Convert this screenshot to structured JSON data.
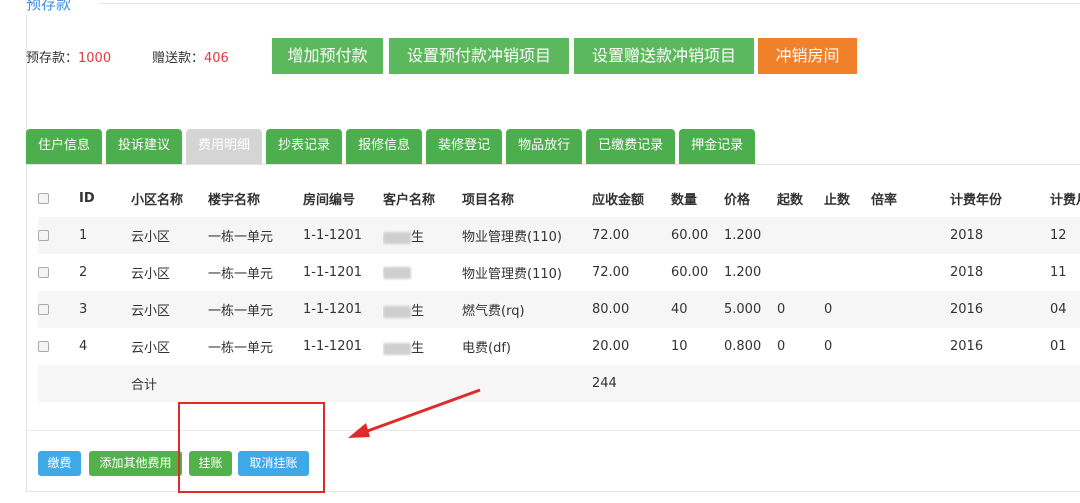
{
  "section_title": "预存款",
  "balance": {
    "prepaid_label": "预存款：",
    "prepaid_value": "1000",
    "gift_label": "赠送款：",
    "gift_value": "406"
  },
  "top_buttons": {
    "add_prepay": "增加预付款",
    "set_prepay_offset": "设置预付款冲销项目",
    "set_gift_offset": "设置赠送款冲销项目",
    "offset_room": "冲销房间"
  },
  "tabs": [
    "住户信息",
    "投诉建议",
    "费用明细",
    "抄表记录",
    "报修信息",
    "装修登记",
    "物品放行",
    "已缴费记录",
    "押金记录"
  ],
  "active_tab": "费用明细",
  "table": {
    "headers": [
      "ID",
      "小区名称",
      "楼宇名称",
      "房间编号",
      "客户名称",
      "项目名称",
      "应收金额",
      "数量",
      "价格",
      "起数",
      "止数",
      "倍率",
      "计费年份",
      "计费月份"
    ],
    "rows": [
      {
        "id": "1",
        "community": "云小区",
        "building": "一栋一单元",
        "room": "1-1-1201",
        "customer": "生",
        "item": "物业管理费(110)",
        "amount": "72.00",
        "qty": "60.00",
        "price": "1.200",
        "start": "",
        "end": "",
        "rate": "",
        "year": "2018",
        "month": "12"
      },
      {
        "id": "2",
        "community": "云小区",
        "building": "一栋一单元",
        "room": "1-1-1201",
        "customer": "",
        "item": "物业管理费(110)",
        "amount": "72.00",
        "qty": "60.00",
        "price": "1.200",
        "start": "",
        "end": "",
        "rate": "",
        "year": "2018",
        "month": "11"
      },
      {
        "id": "3",
        "community": "云小区",
        "building": "一栋一单元",
        "room": "1-1-1201",
        "customer": "生",
        "item": "燃气费(rq)",
        "amount": "80.00",
        "qty": "40",
        "price": "5.000",
        "start": "0",
        "end": "0",
        "rate": "",
        "year": "2016",
        "month": "04"
      },
      {
        "id": "4",
        "community": "云小区",
        "building": "一栋一单元",
        "room": "1-1-1201",
        "customer": "生",
        "item": "电费(df)",
        "amount": "20.00",
        "qty": "10",
        "price": "0.800",
        "start": "0",
        "end": "0",
        "rate": "",
        "year": "2016",
        "month": "01"
      }
    ],
    "total_label": "合计",
    "total_value": "244"
  },
  "bottom_buttons": {
    "pay": "缴费",
    "add_other": "添加其他费用",
    "hang": "挂账",
    "cancel_hang": "取消挂账"
  },
  "colors": {
    "green": "#5cb85c",
    "orange": "#f0812a",
    "blue": "#3fa9e8",
    "red_annotation": "#e02a2a"
  }
}
